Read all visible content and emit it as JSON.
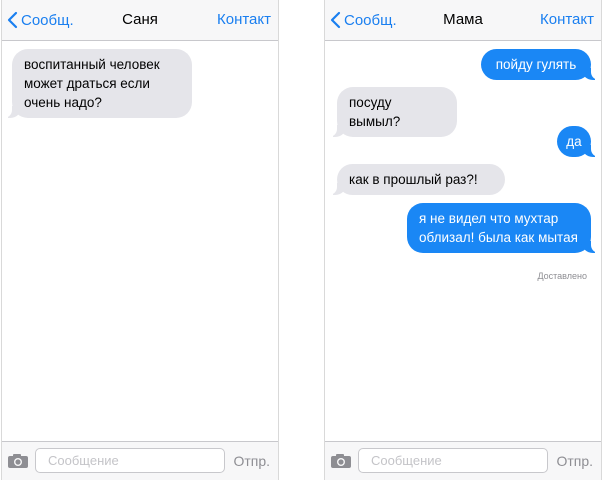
{
  "left": {
    "back_label": "Сообщ.",
    "title": "Саня",
    "contact_label": "Контакт",
    "messages": [
      {
        "text": "воспитанный человек может драться если очень надо?",
        "direction": "incoming"
      }
    ],
    "input_placeholder": "Сообщение",
    "send_label": "Отпр."
  },
  "right": {
    "back_label": "Сообщ.",
    "title": "Мама",
    "contact_label": "Контакт",
    "messages": [
      {
        "text": "пойду гулять",
        "direction": "outgoing"
      },
      {
        "text": "посуду вымыл?",
        "direction": "incoming"
      },
      {
        "text": "да",
        "direction": "outgoing"
      },
      {
        "text": "как в прошлый раз?!",
        "direction": "incoming"
      },
      {
        "text": "я не видел что мухтар облизал! была как мытая",
        "direction": "outgoing"
      }
    ],
    "status": "Доставлено",
    "input_placeholder": "Сообщение",
    "send_label": "Отпр."
  },
  "colors": {
    "accent": "#1a7ff0",
    "outgoing_bubble": "#1a87f5",
    "incoming_bubble": "#e5e5ea"
  },
  "icons": {
    "back": "chevron-left-icon",
    "camera": "camera-icon"
  }
}
